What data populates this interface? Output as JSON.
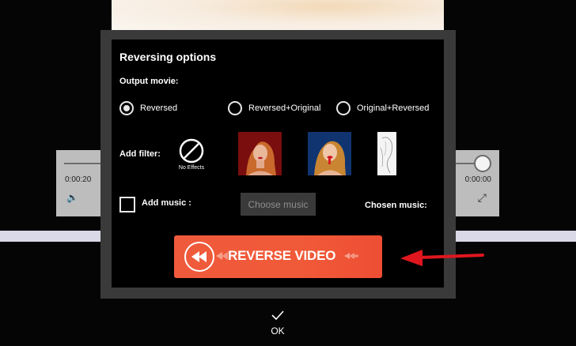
{
  "background": {
    "time_elapsed": "0:00:20",
    "time_total": "0:00:00"
  },
  "dialog": {
    "title": "Reversing options",
    "output_label": "Output movie:",
    "options": [
      {
        "label": "Reversed",
        "checked": true
      },
      {
        "label": "Reversed+Original",
        "checked": false
      },
      {
        "label": "Original+Reversed",
        "checked": false
      }
    ],
    "filter_label": "Add filter:",
    "no_effects_label": "No Effects",
    "filters": [
      "face-portrait-red",
      "face-portrait-blue",
      "sketch-portrait"
    ],
    "music_label": "Add music :",
    "choose_music_label": "Choose music",
    "chosen_music_label": "Chosen music:",
    "reverse_button_label": "REVERSE VIDEO",
    "ok_label": "OK"
  },
  "colors": {
    "accent_button": "#ef5a3c",
    "annotation_arrow": "#e0161e"
  }
}
